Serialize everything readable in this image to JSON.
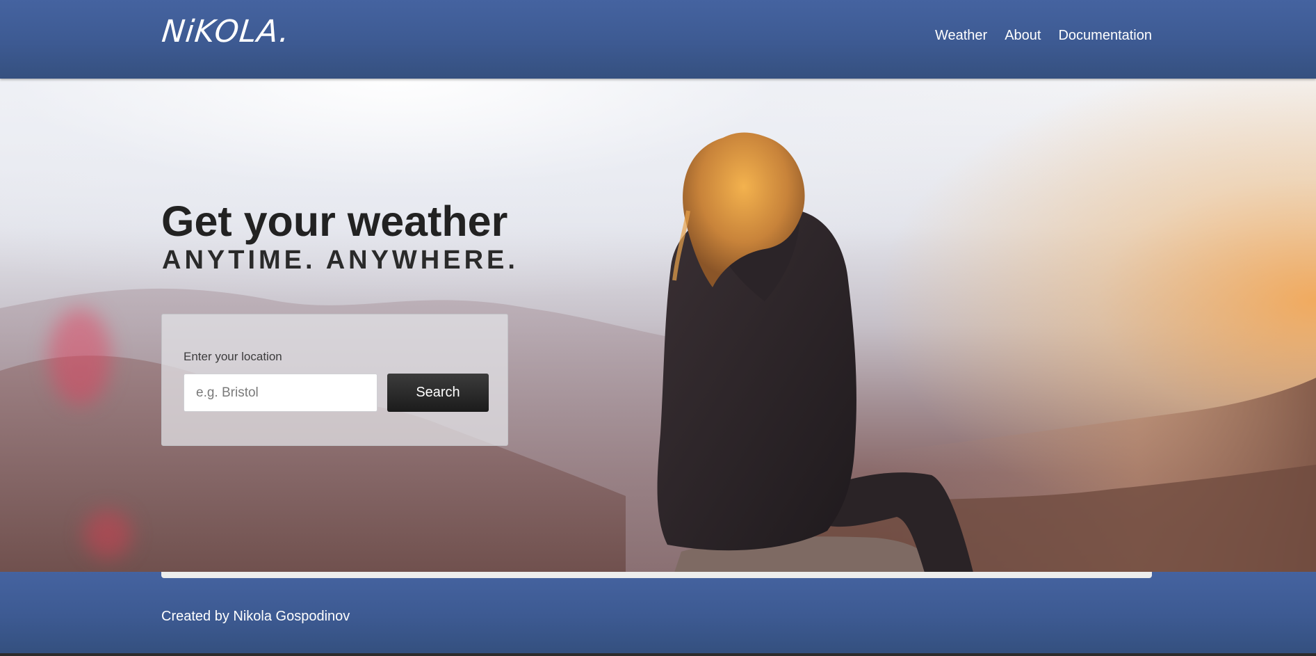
{
  "header": {
    "logo": "NiKOLA",
    "logo_dot": ".",
    "nav": {
      "weather": "Weather",
      "about": "About",
      "documentation": "Documentation"
    }
  },
  "hero": {
    "title": "Get your weather",
    "subtitle": "ANYTIME. ANYWHERE."
  },
  "search": {
    "label": "Enter your location",
    "placeholder": "e.g. Bristol",
    "value": "",
    "button_label": "Search"
  },
  "footer": {
    "text": "Created by Nikola Gospodinov"
  },
  "colors": {
    "header_bg": "#3d5a92",
    "footer_bg": "#3d5a92",
    "button_bg": "#222222",
    "title_text": "#222222"
  }
}
